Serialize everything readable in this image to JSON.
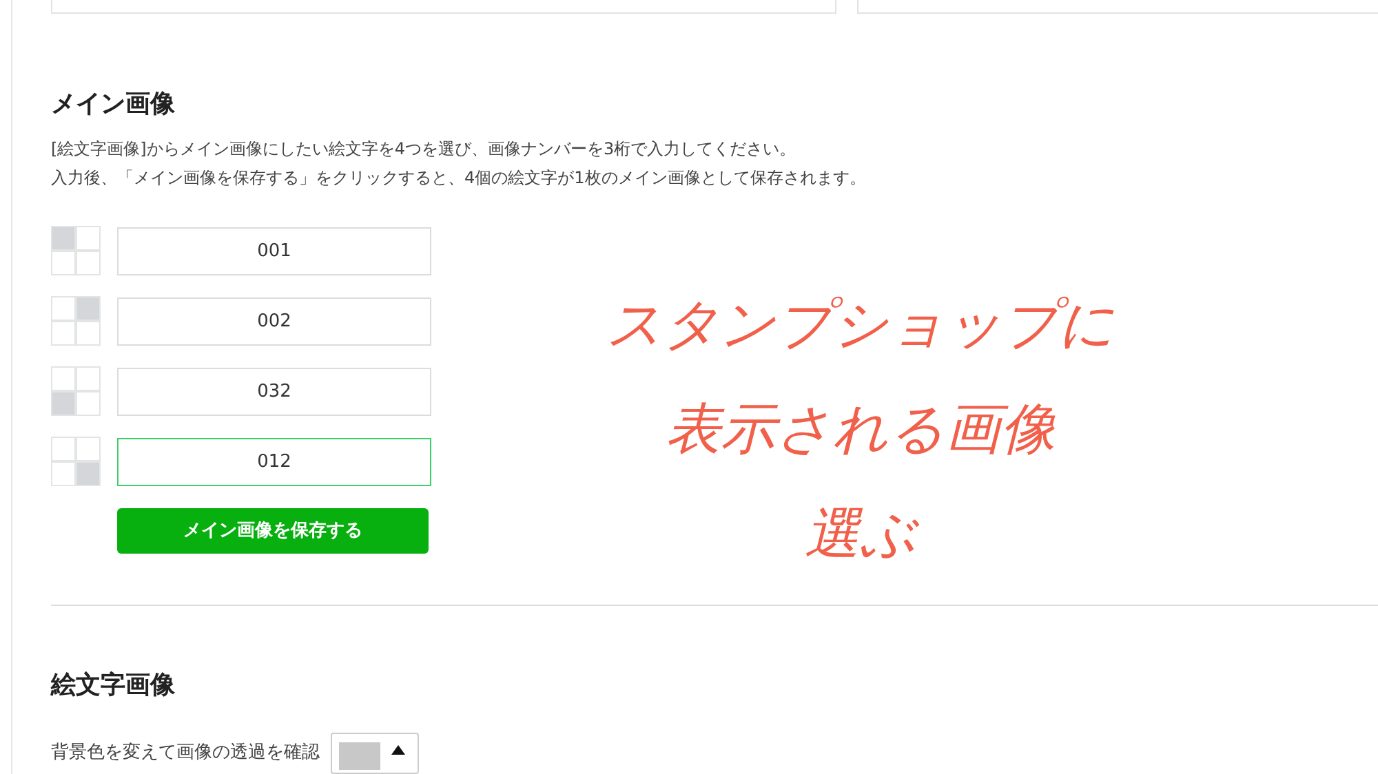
{
  "main_image": {
    "title": "メイン画像",
    "description": [
      "[絵文字画像]からメイン画像にしたい絵文字を4つを選び、画像ナンバーを3桁で入力してください。",
      "入力後、「メイン画像を保存する」をクリックすると、4個の絵文字が1枚のメイン画像として保存されます。"
    ],
    "slots": [
      {
        "value": "001",
        "focused": false
      },
      {
        "value": "002",
        "focused": false
      },
      {
        "value": "032",
        "focused": false
      },
      {
        "value": "012",
        "focused": true
      }
    ],
    "save_button": "メイン画像を保存する"
  },
  "annotation": [
    "スタンプショップに",
    "表示される画像",
    "選ぶ"
  ],
  "emoji_images": {
    "title": "絵文字画像",
    "background_label": "背景色を変えて画像の透過を確認"
  }
}
